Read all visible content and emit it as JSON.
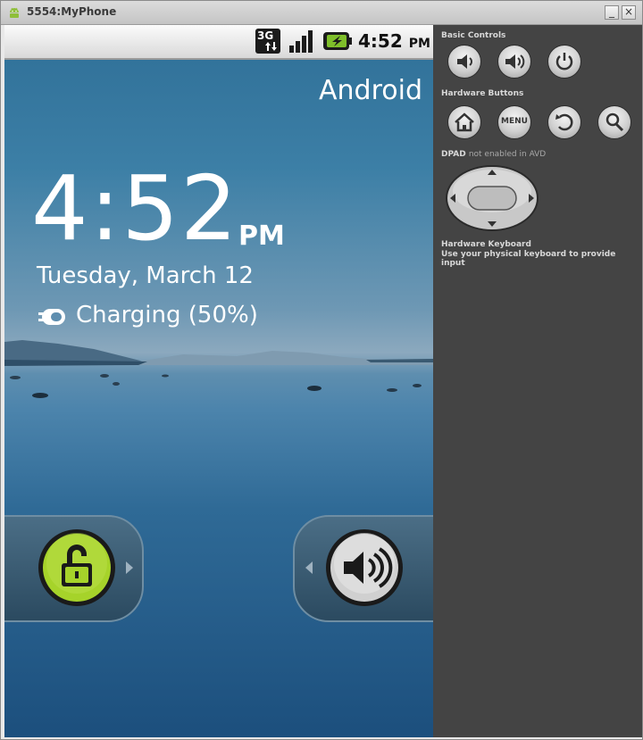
{
  "window": {
    "title": "5554:MyPhone",
    "minimize_label": "_",
    "close_label": "×"
  },
  "statusbar": {
    "network": "3G",
    "time": "4:52",
    "ampm": "PM"
  },
  "lockscreen": {
    "carrier": "Android",
    "clock_time": "4:52",
    "clock_ampm": "PM",
    "date": "Tuesday, March 12",
    "charging": "Charging (50%)"
  },
  "panel": {
    "basic_controls_label": "Basic Controls",
    "hardware_buttons_label": "Hardware Buttons",
    "menu_label": "MENU",
    "dpad_label": "DPAD",
    "dpad_note": "not enabled in AVD",
    "keyboard_label": "Hardware Keyboard",
    "keyboard_note": "Use your physical keyboard to provide input"
  },
  "colors": {
    "panel_bg": "#444444",
    "unlock_green": "#a6d32a",
    "battery_green": "#7fbf2a"
  },
  "icons": [
    "android-icon",
    "3g-icon",
    "signal-icon",
    "battery-charging-icon",
    "charging-plug-icon",
    "unlock-icon",
    "sound-icon",
    "volume-down-icon",
    "volume-up-icon",
    "power-icon",
    "home-icon",
    "back-icon",
    "search-icon",
    "dpad-icon"
  ]
}
